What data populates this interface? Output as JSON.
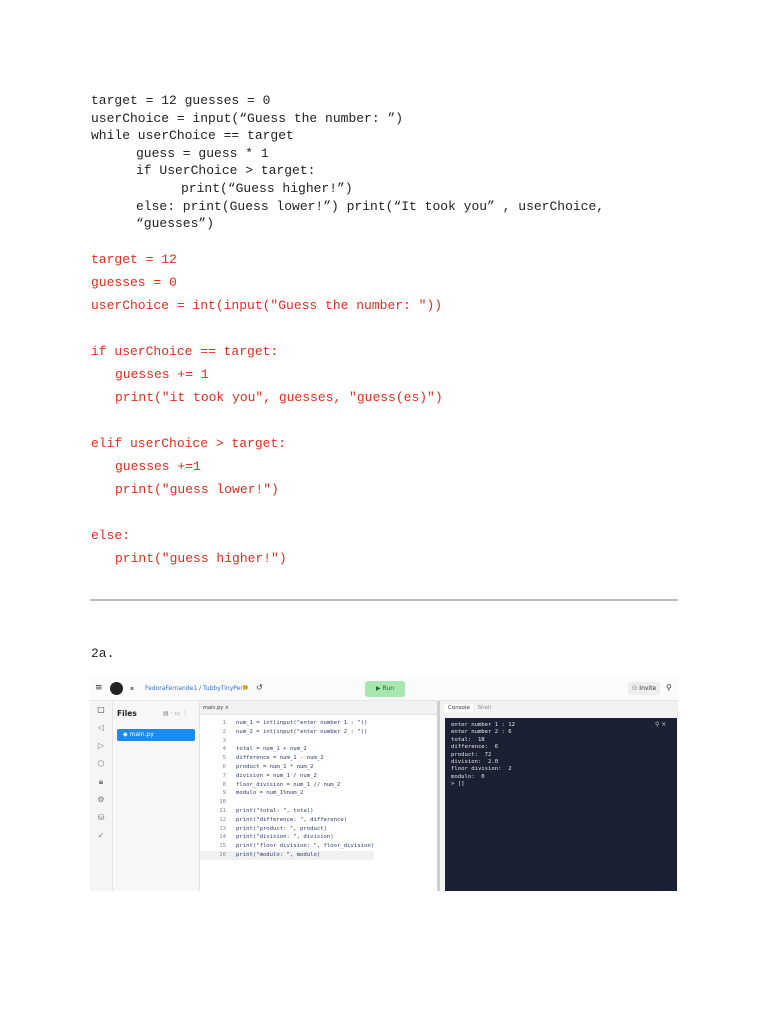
{
  "original_code": [
    "target = 12 guesses = 0",
    "userChoice = input(“Guess the number: ”)",
    "while userChoice == target",
    "guess = guess * 1",
    "if UserChoice > target:",
    "print(“Guess higher!”)",
    "else: print(Guess lower!”) print(“It took you” , userChoice,",
    "“guesses”)"
  ],
  "corrected_code": [
    "target = 12",
    "guesses = 0",
    "userChoice = int(input(\"Guess the number: \"))",
    "",
    "if userChoice == target:",
    "guesses += 1",
    "print(\"it took you\", guesses, \"guess(es)\")",
    "",
    "elif userChoice > target:",
    "guesses +=1",
    "print(\"guess lower!\")",
    "",
    "else:",
    "print(\"guess higher!\")"
  ],
  "section_label": "2a.",
  "replit": {
    "breadcrumb": "FedoraFernande1 / TubbyTinyPerl",
    "run_label": "▶ Run",
    "invite_label": "Invite",
    "files_title": "Files",
    "file_name": "main.py",
    "tab_name": "main.py ×",
    "console_tab": "Console",
    "shell_tab": "Shell",
    "code_lines": [
      "num_1 = int(input(\"enter number 1 : \"))",
      "num_2 = int(input(\"enter number 2 : \"))",
      "",
      "total = num_1 + num_2",
      "difference = num_1 - num_2",
      "product = num_1 * num_2",
      "division = num_1 / num_2",
      "floor_division = num_1 // num_2",
      "modulo = num_1%num_2",
      "",
      "print(\"total: \", total)",
      "print(\"difference: \", difference)",
      "print(\"product: \", product)",
      "print(\"division: \", division)",
      "print(\"floor division: \", floor_division)",
      "print(\"modulo: \", modulo)"
    ],
    "console_lines": [
      "enter number 1 : 12",
      "enter number 2 : 6",
      "total:  18",
      "difference:  6",
      "product:  72",
      "division:  2.0",
      "floor division:  2",
      "modulo:  0",
      "> []"
    ]
  }
}
